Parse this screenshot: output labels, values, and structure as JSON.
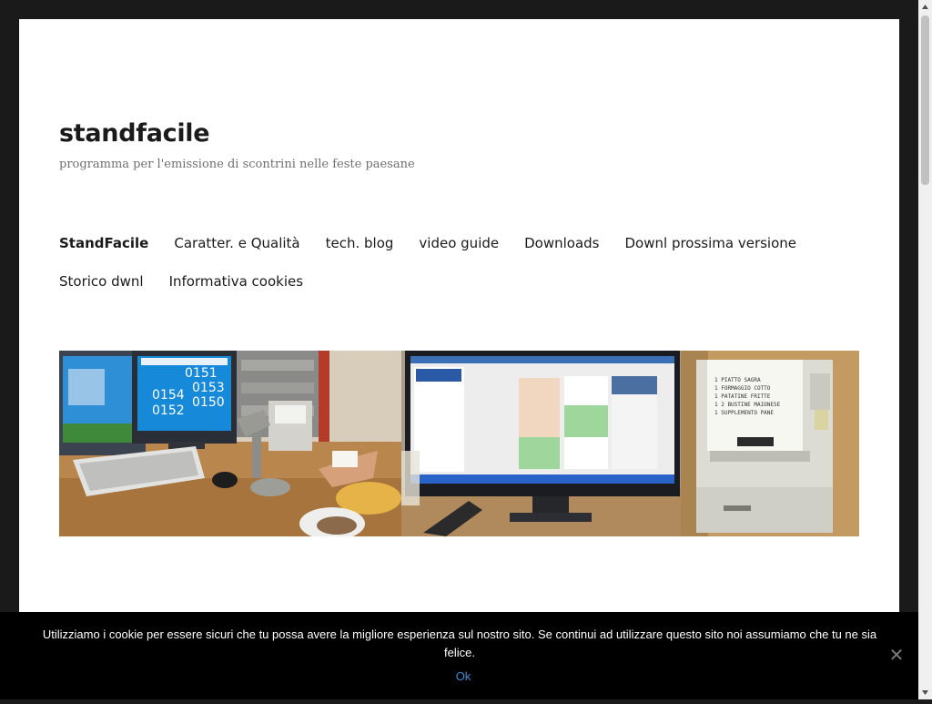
{
  "site": {
    "title": "standfacile",
    "description": "programma per l'emissione di scontrini nelle feste paesane"
  },
  "nav": {
    "items": [
      {
        "label": "StandFacile"
      },
      {
        "label": "Caratter. e Qualità"
      },
      {
        "label": "tech. blog"
      },
      {
        "label": "video guide"
      },
      {
        "label": "Downloads"
      },
      {
        "label": "Downl prossima versione"
      },
      {
        "label": "Storico dwnl"
      },
      {
        "label": "Informativa cookies"
      }
    ]
  },
  "header_image": {
    "queue_numbers": [
      "0151",
      "0154",
      "0153",
      "0152",
      "0150"
    ],
    "receipt_lines": [
      "1 PIATTO SAGRA",
      "1 FORMAGGIO COTTO",
      "1 PATATINE FRITTE",
      "1 2 BUSTINE MAIONESE",
      "1 SUPPLEMENTO PANE"
    ]
  },
  "cookie": {
    "message": "Utilizziamo i cookie per essere sicuri che tu possa avere la migliore esperienza sul nostro sito. Se continui ad utilizzare questo sito noi assumiamo che tu ne sia felice.",
    "ok_label": "Ok",
    "close_glyph": "✕"
  },
  "icons": {
    "scroll_up": "chevron-up-icon",
    "scroll_down": "chevron-down-icon",
    "close": "close-icon"
  }
}
